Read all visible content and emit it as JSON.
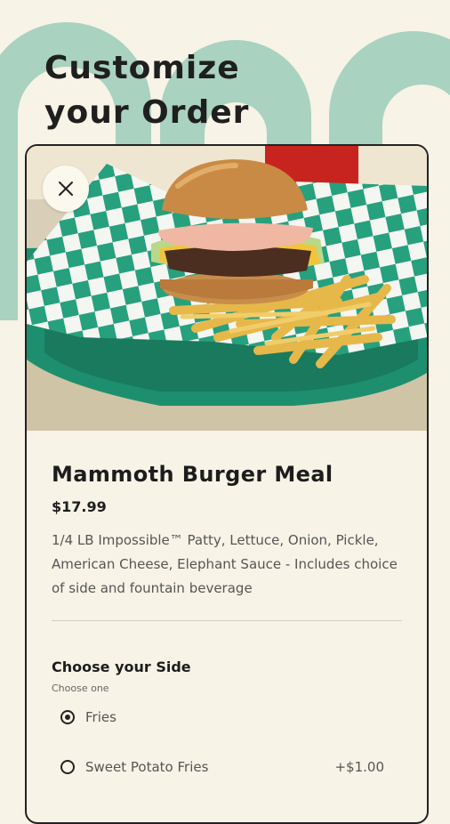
{
  "headline": {
    "line1": "Customize",
    "line2": "your Order"
  },
  "item": {
    "name": "Mammoth Burger Meal",
    "price": "$17.99",
    "description": "1/4 LB Impossible™ Patty, Lettuce, Onion, Pickle, American Cheese, Elephant Sauce - Includes choice of side and fountain beverage"
  },
  "side_section": {
    "title": "Choose your Side",
    "subtitle": "Choose one",
    "options": [
      {
        "label": "Fries",
        "price": "",
        "selected": true
      },
      {
        "label": "Sweet Potato Fries",
        "price": "+$1.00",
        "selected": false
      }
    ]
  },
  "colors": {
    "background": "#f7f3e6",
    "arch": "#a9d2c0",
    "text": "#1d1d1d",
    "basket_green": "#1e8f6e"
  },
  "icons": {
    "close": "close-icon",
    "radio_checked": "radio-checked-icon",
    "radio_unchecked": "radio-unchecked-icon"
  }
}
